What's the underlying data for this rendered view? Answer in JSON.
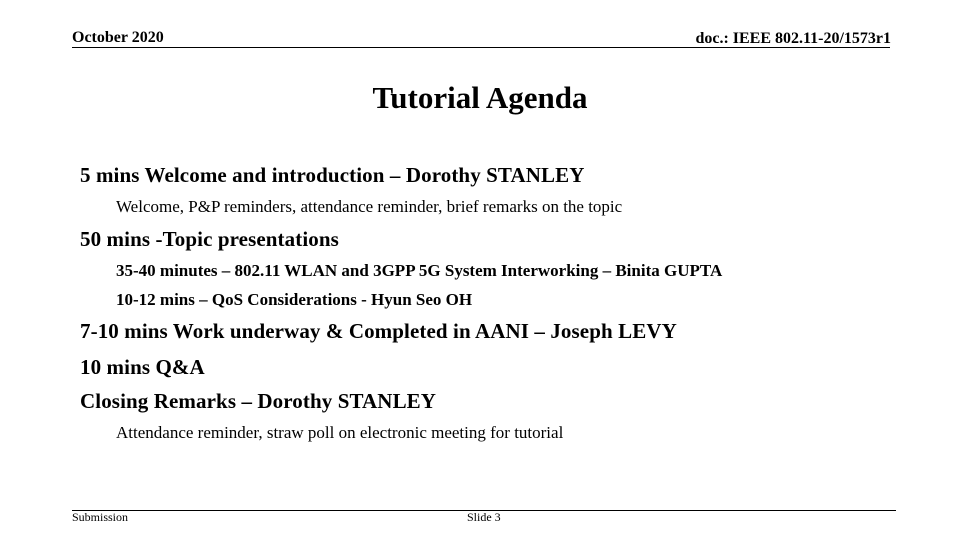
{
  "header": {
    "date": "October 2020",
    "doc_id": "doc.: IEEE 802.11-20/1573r1"
  },
  "slide": {
    "title": "Tutorial Agenda",
    "agenda": [
      {
        "level": 1,
        "text": "5 mins Welcome and introduction – Dorothy STANLEY"
      },
      {
        "level": 2,
        "text": "Welcome, P&P reminders, attendance reminder, brief remarks on the topic"
      },
      {
        "level": 1,
        "text": "50 mins -Topic presentations"
      },
      {
        "level": 2,
        "text": "35-40 minutes – 802.11 WLAN and 3GPP 5G System Interworking – Binita GUPTA"
      },
      {
        "level": 2,
        "text": "10-12 mins – QoS Considerations - Hyun Seo OH"
      },
      {
        "level": 1,
        "text": "7-10 mins Work underway & Completed in AANI – Joseph LEVY"
      },
      {
        "level": 1,
        "text": "10 mins Q&A"
      },
      {
        "level": 1,
        "text": "Closing Remarks – Dorothy STANLEY"
      },
      {
        "level": 2,
        "text": "Attendance reminder, straw poll on electronic meeting for tutorial"
      }
    ]
  },
  "footer": {
    "left": "Submission",
    "slide_number": "Slide 3"
  }
}
